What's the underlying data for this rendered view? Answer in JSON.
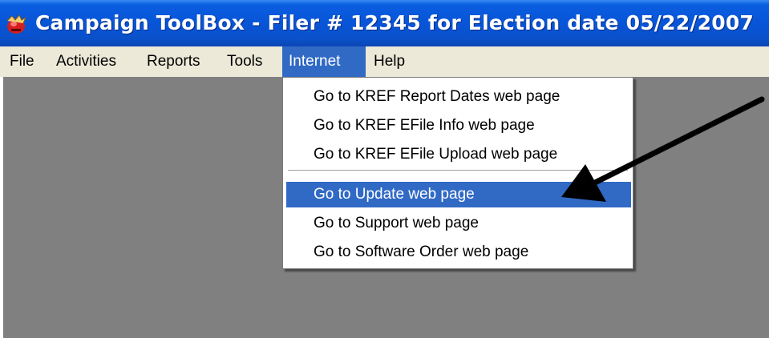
{
  "window": {
    "title": "Campaign ToolBox - Filer # 12345 for Election date 05/22/2007",
    "icon": "app-logo-icon"
  },
  "menubar": {
    "items": [
      {
        "label": "File"
      },
      {
        "label": "Activities"
      },
      {
        "label": "Reports"
      },
      {
        "label": "Tools"
      },
      {
        "label": "Internet",
        "active": true
      },
      {
        "label": "Help"
      }
    ]
  },
  "internet_menu": {
    "items": [
      {
        "label": "Go to KREF Report Dates web page"
      },
      {
        "label": "Go to KREF EFile Info web page"
      },
      {
        "label": "Go to KREF EFile Upload web page"
      },
      {
        "label": "Go to Update web page",
        "highlighted": true
      },
      {
        "label": "Go to Support web page"
      },
      {
        "label": "Go to Software Order web page"
      }
    ]
  },
  "annotation": {
    "type": "arrow",
    "points_to": "Go to Update web page",
    "color": "#000000"
  },
  "colors": {
    "titlebar": "#0854d6",
    "menubar": "#ece9d8",
    "selection": "#316ac5",
    "workspace": "#808080"
  }
}
